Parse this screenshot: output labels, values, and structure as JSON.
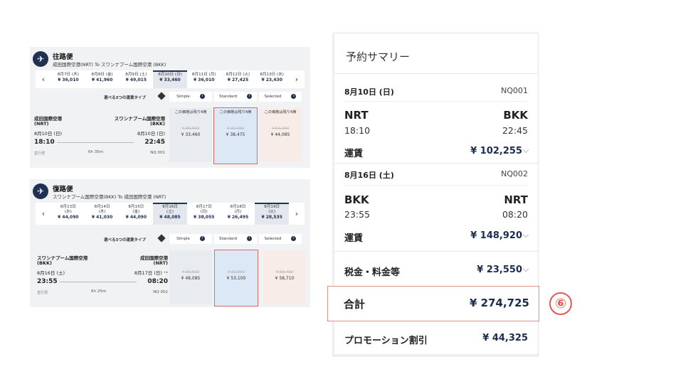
{
  "outbound": {
    "title": "往路便",
    "route": "成田国際空港(NRT) To スワンナプーム国際空港 (BKK)",
    "dates": [
      {
        "date": "8月7日 (木)",
        "price": "¥ 36,010"
      },
      {
        "date": "8月8日 (金)",
        "price": "¥ 41,960"
      },
      {
        "date": "8月9日 (土)",
        "price": "¥ 49,015"
      },
      {
        "date": "8月10日 (日)",
        "price": "¥ 33,460"
      },
      {
        "date": "8月11日 (月)",
        "price": "¥ 36,010"
      },
      {
        "date": "8月12日 (火)",
        "price": "¥ 27,425"
      },
      {
        "date": "8月13日 (水)",
        "price": "¥ 23,430"
      }
    ],
    "fare_type_label": "選べる3つの運賃タイプ",
    "fare_types": [
      "Simple",
      "Standard",
      "Selected"
    ],
    "from_name": "成田国際空港",
    "from_code": "(NRT)",
    "to_name": "スワンナプーム国際空港",
    "to_code": "(BKK)",
    "dep_date": "8月10日 (日)",
    "arr_date": "8月10日 (日)",
    "dep_time": "18:10",
    "arr_time": "22:45",
    "note": "直行便",
    "duration": "6h 35m",
    "flight_no": "NQ 001",
    "fares": [
      {
        "seats": "この価格は残り4席",
        "old": "¥ 35,590",
        "price": "¥ 33,460"
      },
      {
        "seats": "この価格は残り4席",
        "old": "¥ 44,485",
        "price": "¥ 38,475"
      },
      {
        "seats": "この価格は残り4席",
        "old": "¥ 51,090",
        "price": "¥ 44,085"
      }
    ]
  },
  "inbound": {
    "title": "復路便",
    "route": "スワンナプーム国際空港(BKK) To 成田国際空港 (NRT)",
    "dates": [
      {
        "date": "8月13日",
        "dow": "(水)",
        "price": "¥ 44,090"
      },
      {
        "date": "8月14日",
        "dow": "(木)",
        "price": "¥ 41,030"
      },
      {
        "date": "8月15日",
        "dow": "(金)",
        "price": "¥ 44,090"
      },
      {
        "date": "8月16日",
        "dow": "(土)",
        "price": "¥ 48,085"
      },
      {
        "date": "8月17日",
        "dow": "(日)",
        "price": "¥ 38,055"
      },
      {
        "date": "8月18日",
        "dow": "(月)",
        "price": "¥ 26,495"
      },
      {
        "date": "8月19日",
        "dow": "(火)",
        "price": "¥ 28,535"
      }
    ],
    "fare_type_label": "選べる3つの運賃タイプ",
    "fare_types": [
      "Simple",
      "Standard",
      "Selected"
    ],
    "from_name": "スワンナプーム国際空港",
    "from_code": "(BKK)",
    "to_name": "成田国際空港",
    "to_code": "(NRT)",
    "dep_date": "8月16日 (土)",
    "arr_date": "8月17日 (日) ⁺¹",
    "dep_time": "23:55",
    "arr_time": "08:20",
    "note": "直行便",
    "duration": "6h 25m",
    "flight_no": "NQ 002",
    "fares": [
      {
        "seats": "",
        "old": "¥ 35,560",
        "price": "¥ 48,085"
      },
      {
        "seats": "",
        "old": "¥ 31,050",
        "price": "¥ 53,100"
      },
      {
        "seats": "",
        "old": "¥ 68,460",
        "price": "¥ 58,710"
      }
    ]
  },
  "summary": {
    "title": "予約サマリー",
    "leg1": {
      "date": "8月10日 (日)",
      "flight": "NQ001",
      "from": "NRT",
      "to": "BKK",
      "dep": "18:10",
      "arr": "22:45",
      "fare_label": "運賃",
      "fare": "¥ 102,255"
    },
    "leg2": {
      "date": "8月16日 (土)",
      "flight": "NQ002",
      "from": "BKK",
      "to": "NRT",
      "dep": "23:55",
      "arr": "08:20",
      "fare_label": "運賃",
      "fare": "¥ 148,920"
    },
    "tax_label": "税金・料金等",
    "tax": "¥ 23,550",
    "total_label": "合計",
    "total": "¥ 274,725",
    "promo_label": "プロモーション割引",
    "promo": "¥ 44,325"
  },
  "marker": "⑥",
  "icons": {
    "plane": "plane-icon",
    "chevron": "chevron-down-icon",
    "info": "info-icon"
  },
  "colors": {
    "navy": "#1f3252",
    "highlight": "#e4908a",
    "marker": "#e8574f"
  }
}
